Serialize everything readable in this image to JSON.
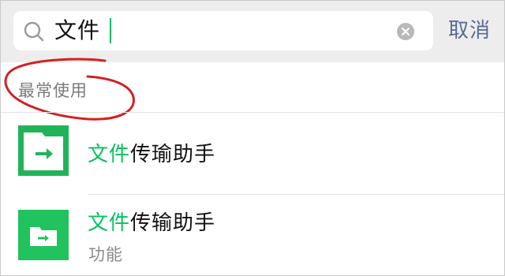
{
  "search": {
    "query": "文件"
  },
  "cancel_label": "取消",
  "section": {
    "title": "最常使用"
  },
  "results": [
    {
      "title_highlight": "文件",
      "title_rest": "传瑜助手",
      "subtitle": "",
      "icon": "folder-arrow-icon"
    },
    {
      "title_highlight": "文件",
      "title_rest": "传输助手",
      "subtitle": "功能",
      "icon": "folder-arrow-icon"
    }
  ],
  "colors": {
    "highlight": "#07c160",
    "cancel": "#576b95",
    "annotation": "#d42020"
  }
}
